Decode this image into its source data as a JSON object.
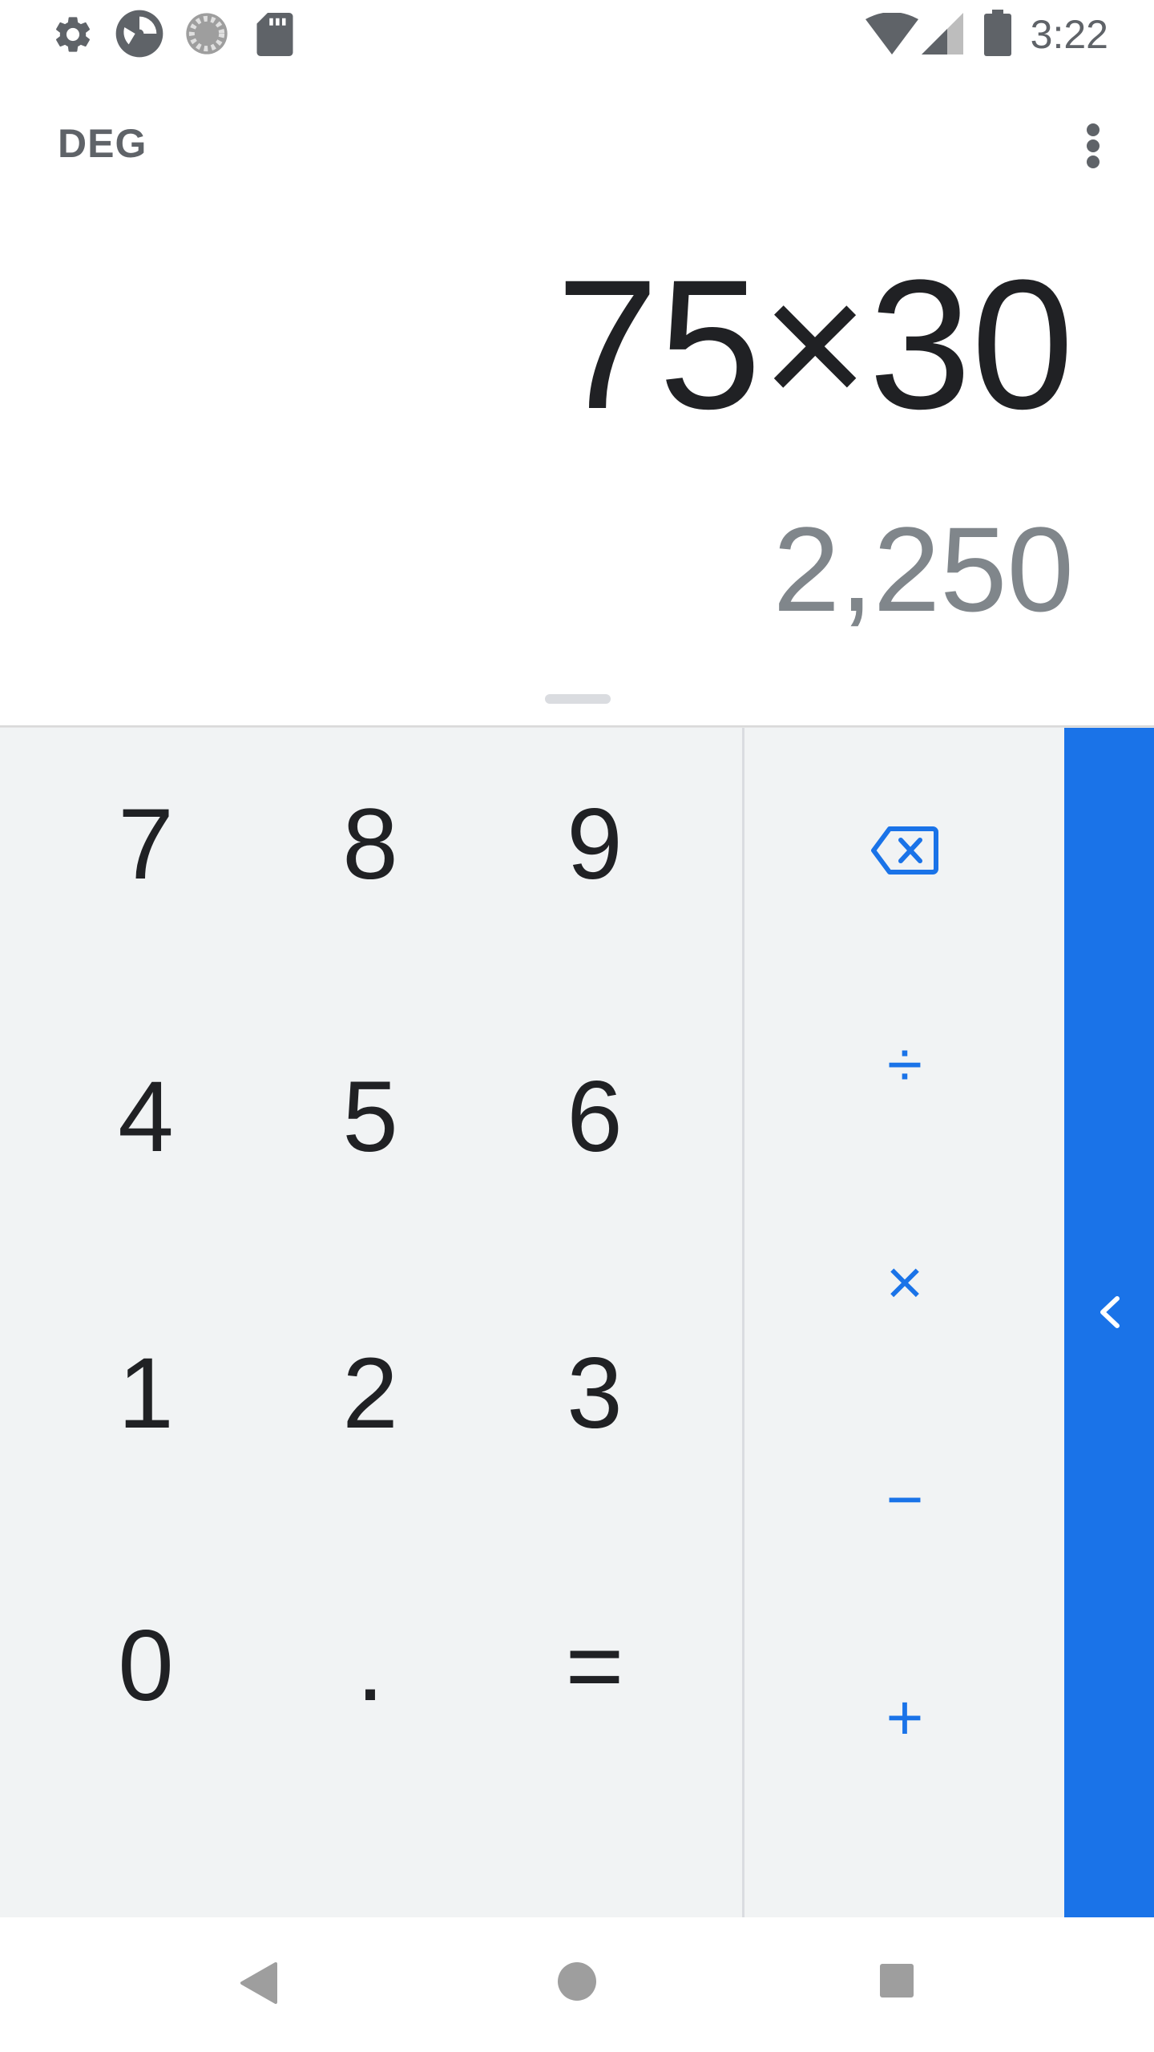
{
  "status_bar": {
    "time": "3:22",
    "icons": [
      "settings-icon",
      "app-icon",
      "loading-icon",
      "sd-card-icon",
      "wifi-icon",
      "signal-icon",
      "battery-icon"
    ]
  },
  "app_bar": {
    "mode": "DEG",
    "overflow_icon": "more-vert-icon"
  },
  "display": {
    "expression": "75×30",
    "result": "2,250"
  },
  "keypad": {
    "digits": {
      "k7": "7",
      "k8": "8",
      "k9": "9",
      "k4": "4",
      "k5": "5",
      "k6": "6",
      "k1": "1",
      "k2": "2",
      "k3": "3",
      "k0": "0",
      "decimal": ".",
      "equals": "="
    },
    "operators": {
      "backspace_icon": "backspace-icon",
      "divide": "÷",
      "multiply": "×",
      "minus": "−",
      "plus": "+"
    },
    "side_panel_icon": "chevron-left-icon"
  },
  "nav_bar": {
    "icons": [
      "back-icon",
      "home-icon",
      "recents-icon"
    ]
  },
  "colors": {
    "accent": "#1a73e8",
    "keypad_bg": "#f1f3f4",
    "text_primary": "#202124",
    "text_secondary": "#5f6368",
    "result_text": "#80868b"
  }
}
